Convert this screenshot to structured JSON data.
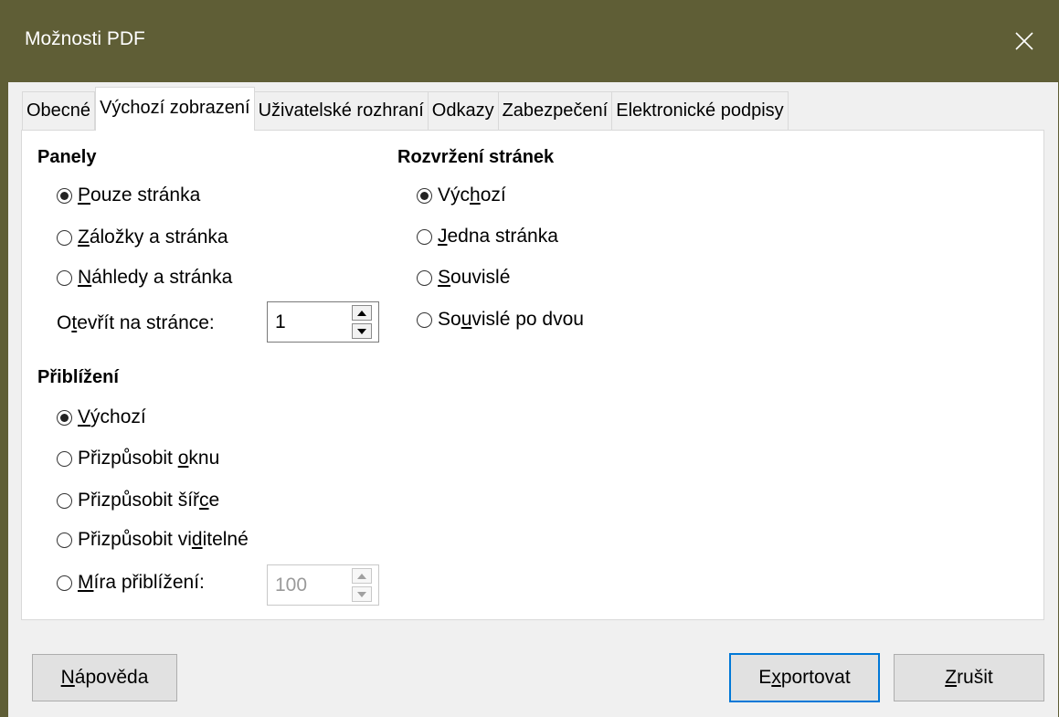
{
  "window": {
    "title": "Možnosti PDF"
  },
  "tabs": [
    {
      "label": "Obecné"
    },
    {
      "label": "Výchozí zobrazení"
    },
    {
      "label": "Uživatelské rozhraní"
    },
    {
      "label": "Odkazy"
    },
    {
      "label": "Zabezpečení"
    },
    {
      "label": "Elektronické podpisy"
    }
  ],
  "active_tab": "Výchozí zobrazení",
  "panes": {
    "heading": "Panely",
    "options": [
      {
        "pre": "",
        "u": "P",
        "post": "ouze stránka",
        "checked": true
      },
      {
        "pre": "",
        "u": "Z",
        "post": "áložky a stránka",
        "checked": false
      },
      {
        "pre": "",
        "u": "N",
        "post": "áhledy a stránka",
        "checked": false
      }
    ],
    "open_on_page": {
      "pre": "O",
      "u": "t",
      "post": "evřít na stránce:",
      "value": "1"
    }
  },
  "magnification": {
    "heading": "Přiblížení",
    "options": [
      {
        "pre": "",
        "u": "V",
        "post": "ýchozí",
        "checked": true
      },
      {
        "pre": "Přizpůsobit ",
        "u": "o",
        "post": "knu",
        "checked": false
      },
      {
        "pre": "Přizpůsobit šíř",
        "u": "c",
        "post": "e",
        "checked": false
      },
      {
        "pre": "Přizpůsobit vi",
        "u": "d",
        "post": "itelné",
        "checked": false
      },
      {
        "pre": "",
        "u": "M",
        "post": "íra přiblížení:",
        "checked": false
      }
    ],
    "zoom_value": "100"
  },
  "page_layout": {
    "heading": "Rozvržení stránek",
    "options": [
      {
        "pre": "Výc",
        "u": "h",
        "post": "ozí",
        "checked": true
      },
      {
        "pre": "",
        "u": "J",
        "post": "edna stránka",
        "checked": false
      },
      {
        "pre": "",
        "u": "S",
        "post": "ouvislé",
        "checked": false
      },
      {
        "pre": "So",
        "u": "u",
        "post": "vislé po dvou",
        "checked": false
      }
    ]
  },
  "buttons": {
    "help": {
      "pre": "",
      "u": "N",
      "post": "ápověda"
    },
    "export": {
      "pre": "E",
      "u": "x",
      "post": "portovat"
    },
    "cancel": {
      "pre": "",
      "u": "Z",
      "post": "rušit"
    }
  },
  "colors": {
    "titlebar": "#5f5e36",
    "accent": "#0078d7"
  }
}
